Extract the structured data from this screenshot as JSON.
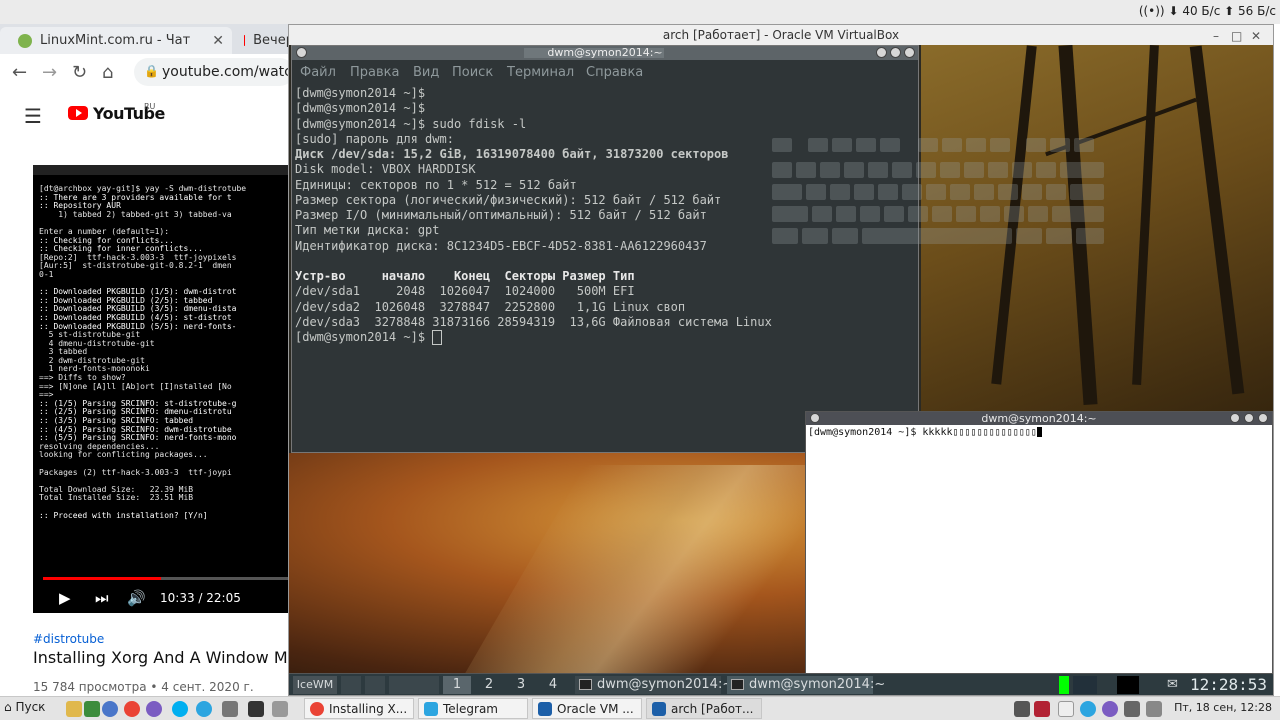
{
  "host_topbar": {
    "net_down": "40 Б/с",
    "net_up": "56 Б/с"
  },
  "browser": {
    "tabs": [
      {
        "title": "LinuxMint.com.ru - Чат",
        "close": "✕"
      },
      {
        "title": "Вечер"
      }
    ],
    "nav": {
      "back": "←",
      "forward": "→",
      "reload": "↻",
      "home": "⌂"
    },
    "url": "youtube.com/watch?v",
    "youtube": {
      "logo_text": "YouTube",
      "region": "RU",
      "menu_icon": "☰",
      "video_time": "10:33 / 22:05",
      "progress": 0.477,
      "tag": "#distrotube",
      "title": "Installing Xorg And A Window Manager",
      "meta": "15 784 просмотра • 4 сент. 2020 г.",
      "video_terminal_lines": [
        "[dt@archbox yay-git]$ yay -S dwm-distrotube",
        ":: There are 3 providers available for t",
        ":: Repository AUR",
        "    1) tabbed 2) tabbed-git 3) tabbed-va",
        "",
        "Enter a number (default=1):",
        ":: Checking for conflicts...",
        ":: Checking for inner conflicts...",
        "[Repo:2]  ttf-hack-3.003-3  ttf-joypixels",
        "[Aur:5]  st-distrotube-git-0.8.2-1  dmen",
        "0-1",
        "",
        ":: Downloaded PKGBUILD (1/5): dwm-distrot",
        ":: Downloaded PKGBUILD (2/5): tabbed",
        ":: Downloaded PKGBUILD (3/5): dmenu-dista",
        ":: Downloaded PKGBUILD (4/5): st-distrot",
        ":: Downloaded PKGBUILD (5/5): nerd-fonts-",
        "  5 st-distrotube-git",
        "  4 dmenu-distrotube-git",
        "  3 tabbed",
        "  2 dwm-distrotube-git",
        "  1 nerd-fonts-mononoki",
        "==> Diffs to show?",
        "==> [N]one [A]ll [Ab]ort [I]nstalled [No",
        "==>",
        ":: (1/5) Parsing SRCINFO: st-distrotube-g",
        ":: (2/5) Parsing SRCINFO: dmenu-distrotu",
        ":: (3/5) Parsing SRCINFO: tabbed",
        ":: (4/5) Parsing SRCINFO: dwm-distrotube",
        ":: (5/5) Parsing SRCINFO: nerd-fonts-mono",
        "resolving dependencies...",
        "looking for conflicting packages...",
        "",
        "Packages (2) ttf-hack-3.003-3  ttf-joypi",
        "",
        "Total Download Size:   22.39 MiB",
        "Total Installed Size:  23.51 MiB",
        "",
        ":: Proceed with installation? [Y/n]"
      ]
    }
  },
  "vbox": {
    "title": "arch [Работает] - Oracle VM VirtualBox",
    "btn_minimize": "–",
    "btn_maximize": "□",
    "btn_close": "✕"
  },
  "term1": {
    "title": "dwm@symon2014:~",
    "menu": [
      "Файл",
      "Правка",
      "Вид",
      "Поиск",
      "Терминал",
      "Справка"
    ],
    "lines": [
      "[dwm@symon2014 ~]$",
      "[dwm@symon2014 ~]$",
      "[dwm@symon2014 ~]$ sudo fdisk -l",
      "[sudo] пароль для dwm:",
      "Диск /dev/sda: 15,2 GiB, 16319078400 байт, 31873200 секторов",
      "Disk model: VBOX HARDDISK",
      "Единицы: секторов по 1 * 512 = 512 байт",
      "Размер сектора (логический/физический): 512 байт / 512 байт",
      "Размер I/O (минимальный/оптимальный): 512 байт / 512 байт",
      "Тип метки диска: gpt",
      "Идентификатор диска: 8C1234D5-EBCF-4D52-8381-AA6122960437",
      "",
      "Устр-во     начало    Конец  Секторы Размер Тип",
      "/dev/sda1     2048  1026047  1024000   500M EFI",
      "/dev/sda2  1026048  3278847  2252800   1,1G Linux своп",
      "/dev/sda3  3278848 31873166 28594319  13,6G Файловая система Linux",
      "[dwm@symon2014 ~]$ "
    ]
  },
  "term2": {
    "title": "dwm@symon2014:~",
    "line": "[dwm@symon2014 ~]$ kkkkk▯▯▯▯▯▯▯▯▯▯▯▯▯▯"
  },
  "icewm": {
    "start_label": "IceWM",
    "workspaces": [
      "1",
      "2",
      "3",
      "4"
    ],
    "tasks": [
      "dwm@symon2014:~",
      "dwm@symon2014:~"
    ],
    "clock": "12:28:53"
  },
  "host_panel": {
    "start_label": "Пуск",
    "tasks": [
      {
        "label": "Installing X...",
        "icon_color": "#4285f4"
      },
      {
        "label": "Telegram",
        "icon_color": "#2ca5e0"
      },
      {
        "label": "Oracle VM ...",
        "icon_color": "#1c5fa8"
      },
      {
        "label": "arch [Работ...",
        "icon_color": "#1c5fa8"
      }
    ],
    "clock": "Пт, 18 сен, 12:28"
  },
  "colors": {
    "accent_red": "#ff0000",
    "link_blue": "#065fd4",
    "terminal_bg": "#2f3537",
    "icewm_bg": "#2d3a3f"
  }
}
